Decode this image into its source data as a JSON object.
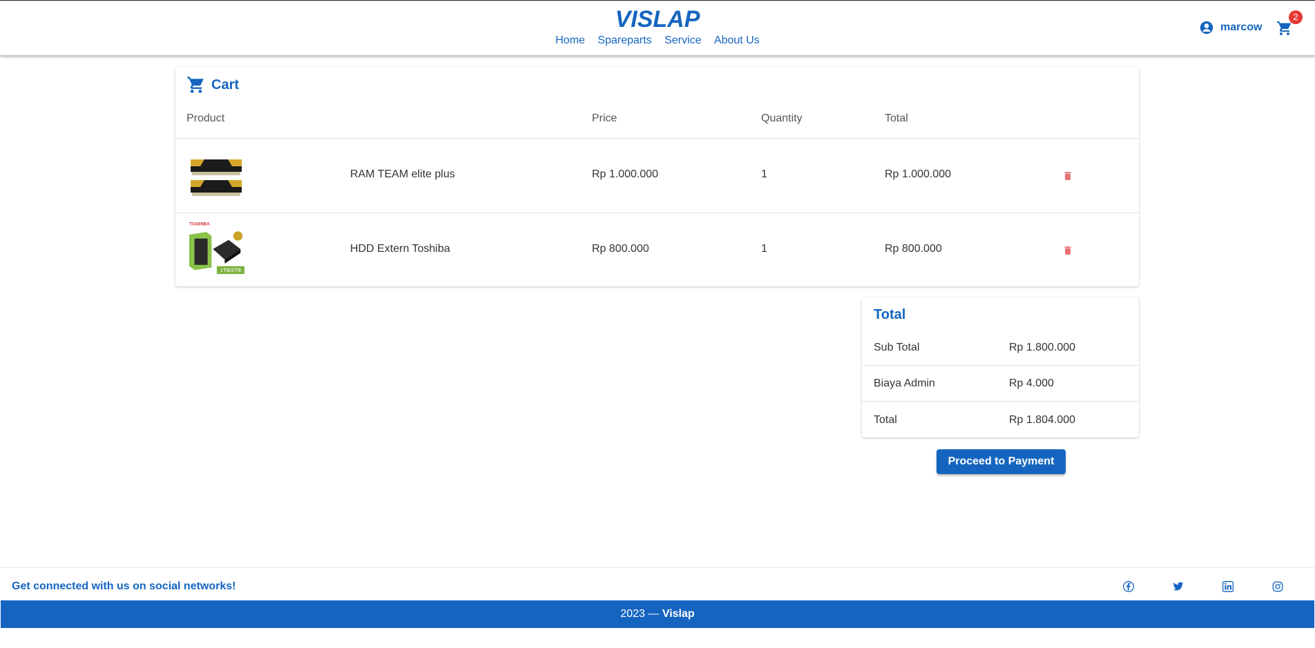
{
  "header": {
    "logo_text": "VISLAP",
    "nav": [
      "Home",
      "Spareparts",
      "Service",
      "About Us"
    ],
    "username": "marcow",
    "cart_count": "2"
  },
  "cart": {
    "title": "Cart",
    "columns": [
      "Product",
      "Price",
      "Quantity",
      "Total"
    ],
    "items": [
      {
        "name": "RAM TEAM elite plus",
        "price": "Rp 1.000.000",
        "quantity": "1",
        "total": "Rp 1.000.000"
      },
      {
        "name": "HDD Extern Toshiba",
        "price": "Rp 800.000",
        "quantity": "1",
        "total": "Rp 800.000"
      }
    ]
  },
  "summary": {
    "title": "Total",
    "rows": [
      {
        "label": "Sub Total",
        "value": "Rp 1.800.000"
      },
      {
        "label": "Biaya Admin",
        "value": "Rp 4.000"
      },
      {
        "label": "Total",
        "value": "Rp 1.804.000"
      }
    ],
    "button": "Proceed to Payment"
  },
  "product_images": {
    "toshiba_brand": "TOSHIBA",
    "toshiba_capacity": "1TB/2TB"
  },
  "footer": {
    "social_text": "Get connected with us on social networks!",
    "year_prefix": "2023 — ",
    "brand": "Vislap"
  },
  "colors": {
    "primary": "#1565c0",
    "danger": "#e57373",
    "badge": "#e53935"
  }
}
